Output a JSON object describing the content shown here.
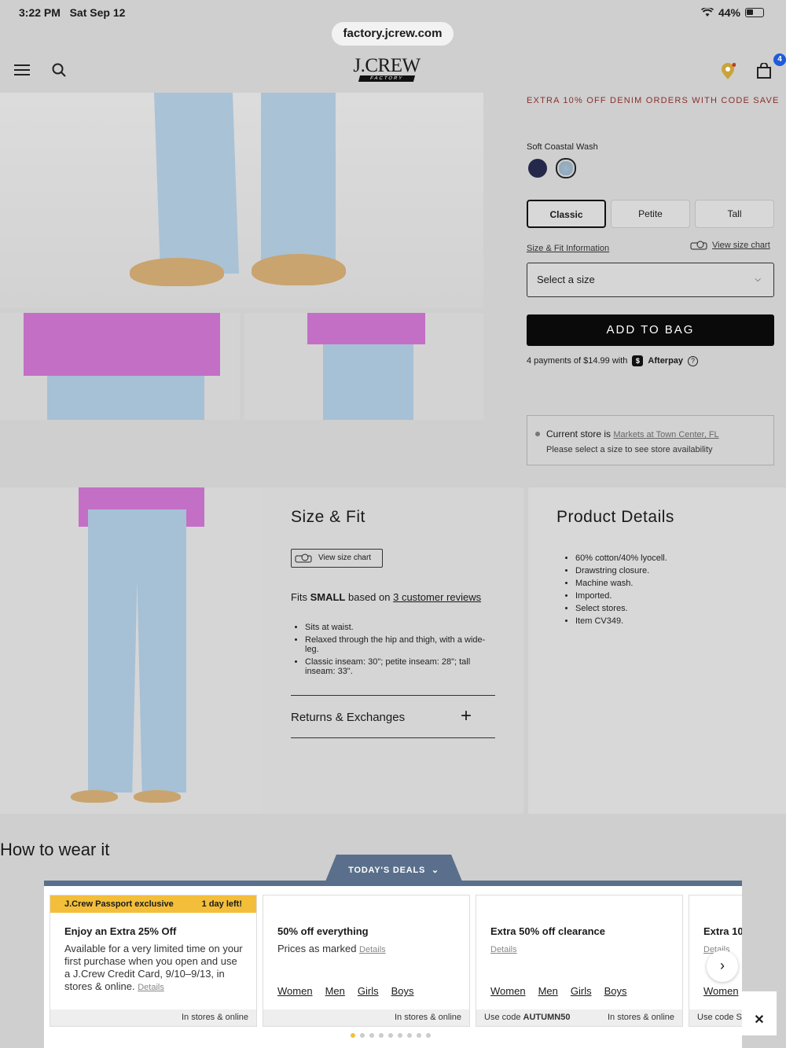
{
  "status": {
    "time": "3:22 PM",
    "date": "Sat Sep 12",
    "battery": "44%"
  },
  "browser": {
    "url": "factory.jcrew.com"
  },
  "header": {
    "logo": "J.CREW",
    "logo_sub": "FACTORY",
    "bag_count": "4"
  },
  "product": {
    "promo": "EXTRA 10% OFF DENIM ORDERS WITH CODE SAVE",
    "color_label": "Soft Coastal Wash",
    "fits": [
      "Classic",
      "Petite",
      "Tall"
    ],
    "size_fit_link": "Size & Fit Information",
    "view_size_chart": "View size chart",
    "size_select": "Select a size",
    "add_to_bag": "ADD TO BAG",
    "afterpay_text": "4 payments of $14.99 with",
    "afterpay_brand": "Afterpay",
    "store_prefix": "Current store is",
    "store_name": "Markets at Town Center, FL",
    "store_note": "Please select a size to see store availability"
  },
  "size_fit": {
    "title": "Size & Fit",
    "chart_button": "View size chart",
    "fits_prefix": "Fits",
    "fits_size": "SMALL",
    "fits_middle": "based on",
    "fits_reviews": "3 customer reviews",
    "bullets": [
      "Sits at waist.",
      "Relaxed through the hip and thigh, with a wide-leg.",
      "Classic inseam: 30\"; petite inseam: 28\"; tall inseam: 33\"."
    ],
    "returns": "Returns & Exchanges"
  },
  "product_details": {
    "title": "Product Details",
    "bullets": [
      "60% cotton/40% lyocell.",
      "Drawstring closure.",
      "Machine wash.",
      "Imported.",
      "Select stores.",
      "Item CV349."
    ]
  },
  "how_to_wear": "How to wear it",
  "deals": {
    "tab_label": "TODAY'S DEALS",
    "cards": [
      {
        "banner_left": "J.Crew Passport exclusive",
        "banner_right": "1 day left!",
        "title": "Enjoy an Extra 25% Off",
        "desc": "Available for a very limited time on your first purchase when you open and use a J.Crew Credit Card, 9/10–9/13, in stores & online.",
        "details": "Details",
        "foot_right": "In stores & online"
      },
      {
        "title": "50% off everything",
        "desc": "Prices as marked",
        "details": "Details",
        "links": [
          "Women",
          "Men",
          "Girls",
          "Boys"
        ],
        "foot_right": "In stores & online"
      },
      {
        "title": "Extra 50% off clearance",
        "details": "Details",
        "links": [
          "Women",
          "Men",
          "Girls",
          "Boys"
        ],
        "foot_left_prefix": "Use code",
        "foot_left_code": "AUTUMN50",
        "foot_right": "In stores & online"
      },
      {
        "title": "Extra 10",
        "details": "Details",
        "links": [
          "Women"
        ],
        "foot_left": "Use code S"
      }
    ],
    "pagination_total": 9,
    "pagination_active": 1
  }
}
